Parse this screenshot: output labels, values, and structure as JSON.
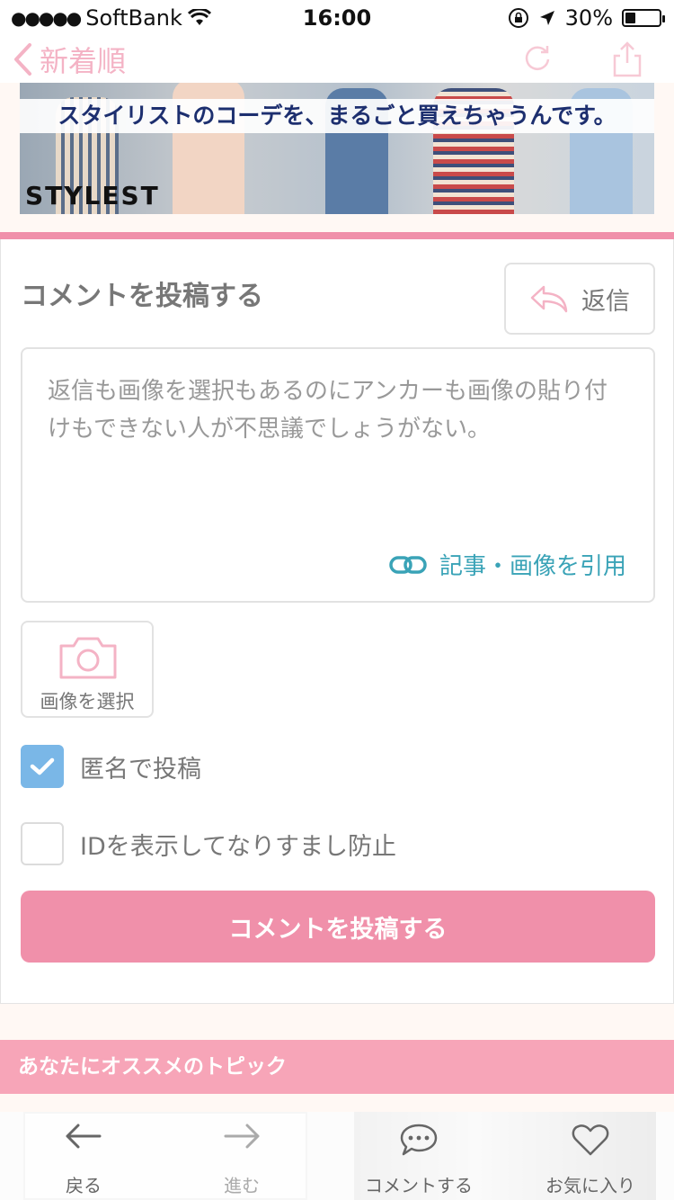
{
  "status_bar": {
    "signal_dots": "●●●●●",
    "carrier": "SoftBank",
    "time": "16:00",
    "battery_percent": "30%",
    "battery_level": 0.3
  },
  "nav": {
    "back_label": "新着順"
  },
  "banner": {
    "tagline": "スタイリストのコーデを、まるごと買えちゃうんです。",
    "brand": "STYLEST"
  },
  "comment_form": {
    "title": "コメントを投稿する",
    "reply_button": "返信",
    "text_value": "返信も画像を選択もあるのにアンカーも画像の貼り付けもできない人が不思議でしょうがない。",
    "quote_link": "記事・画像を引用",
    "image_select": "画像を選択",
    "anonymous_label": "匿名で投稿",
    "anonymous_checked": true,
    "show_id_label": "IDを表示してなりすまし防止",
    "show_id_checked": false,
    "submit_label": "コメントを投稿する"
  },
  "recommend": {
    "header": "あなたにオススメのトピック"
  },
  "tab_bar": {
    "back": "戻る",
    "forward": "進む",
    "comment": "コメントする",
    "favorite": "お気に入り"
  },
  "colors": {
    "accent_pink": "#f090aa",
    "link_teal": "#3aa3b7",
    "checkbox_blue": "#7ab7e7"
  }
}
